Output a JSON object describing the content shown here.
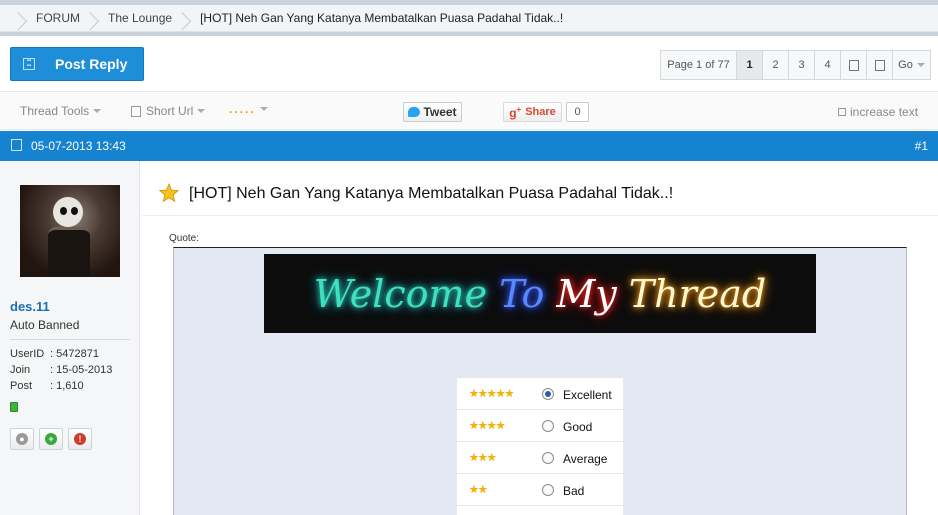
{
  "breadcrumb": {
    "items": [
      "FORUM",
      "The Lounge",
      "[HOT] Neh Gan Yang Katanya Membatalkan Puasa Padahal Tidak..!"
    ]
  },
  "toolbar": {
    "post_reply": "Post Reply",
    "page_label": "Page 1 of 77",
    "pages": [
      "1",
      "2",
      "3",
      "4"
    ],
    "go": "Go"
  },
  "tools": {
    "thread_tools": "Thread Tools",
    "short_url": "Short Url",
    "dots": ".....",
    "tweet": "Tweet",
    "share": "Share",
    "share_count": "0",
    "increase_text": "increase text"
  },
  "post": {
    "date": "05-07-2013 13:43",
    "number": "#1",
    "title": "[HOT] Neh Gan Yang Katanya Membatalkan Puasa Padahal Tidak..!",
    "quote_label": "Quote:",
    "banner": [
      "Welcome",
      "To",
      "My",
      "Thread"
    ]
  },
  "user": {
    "name": "des.11",
    "title": "Auto Banned",
    "fields": [
      {
        "k": "UserID",
        "v": ": 5472871"
      },
      {
        "k": "Join",
        "v": ": 15-05-2013"
      },
      {
        "k": "Post",
        "v": ": 1,610"
      }
    ]
  },
  "poll": [
    {
      "stars": "★★★★★",
      "label": "Excellent",
      "checked": true
    },
    {
      "stars": "★★★★",
      "label": "Good",
      "checked": false
    },
    {
      "stars": "★★★",
      "label": "Average",
      "checked": false
    },
    {
      "stars": "★★",
      "label": "Bad",
      "checked": false
    }
  ],
  "colors": {
    "accent": "#1583d0",
    "button": "#1e8ed8",
    "username": "#1b6fb3"
  }
}
